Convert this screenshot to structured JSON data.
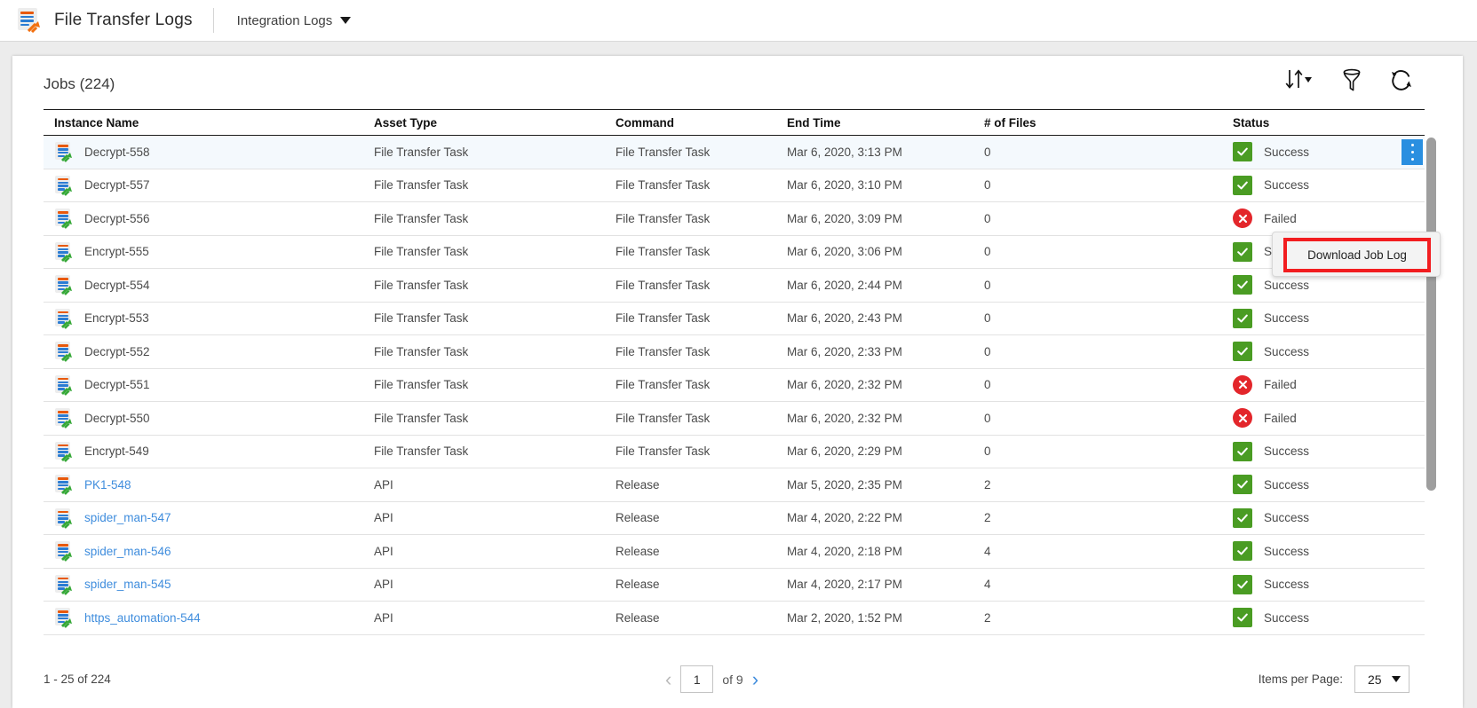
{
  "appbar": {
    "logo_icon": "file-transfer-logs-icon",
    "title": "File Transfer Logs",
    "menu_label": "Integration Logs",
    "menu_caret_icon": "chevron-down-icon"
  },
  "panel": {
    "title": "Jobs (224)",
    "actions": [
      {
        "name": "sort-icon",
        "label": "Sort"
      },
      {
        "name": "filter-icon",
        "label": "Filter"
      },
      {
        "name": "refresh-icon",
        "label": "Refresh"
      }
    ]
  },
  "table": {
    "columns": [
      "Instance Name",
      "Asset Type",
      "Command",
      "End Time",
      "# of Files",
      "Status"
    ],
    "rows": [
      {
        "name": "Decrypt-558",
        "link": false,
        "asset": "File Transfer Task",
        "command": "File Transfer Task",
        "end_time": "Mar 6, 2020, 3:13 PM",
        "files": "0",
        "status": "Success",
        "selected": true
      },
      {
        "name": "Decrypt-557",
        "link": false,
        "asset": "File Transfer Task",
        "command": "File Transfer Task",
        "end_time": "Mar 6, 2020, 3:10 PM",
        "files": "0",
        "status": "Success",
        "selected": false
      },
      {
        "name": "Decrypt-556",
        "link": false,
        "asset": "File Transfer Task",
        "command": "File Transfer Task",
        "end_time": "Mar 6, 2020, 3:09 PM",
        "files": "0",
        "status": "Failed",
        "selected": false
      },
      {
        "name": "Encrypt-555",
        "link": false,
        "asset": "File Transfer Task",
        "command": "File Transfer Task",
        "end_time": "Mar 6, 2020, 3:06 PM",
        "files": "0",
        "status": "Success",
        "selected": false
      },
      {
        "name": "Decrypt-554",
        "link": false,
        "asset": "File Transfer Task",
        "command": "File Transfer Task",
        "end_time": "Mar 6, 2020, 2:44 PM",
        "files": "0",
        "status": "Success",
        "selected": false
      },
      {
        "name": "Encrypt-553",
        "link": false,
        "asset": "File Transfer Task",
        "command": "File Transfer Task",
        "end_time": "Mar 6, 2020, 2:43 PM",
        "files": "0",
        "status": "Success",
        "selected": false
      },
      {
        "name": "Decrypt-552",
        "link": false,
        "asset": "File Transfer Task",
        "command": "File Transfer Task",
        "end_time": "Mar 6, 2020, 2:33 PM",
        "files": "0",
        "status": "Success",
        "selected": false
      },
      {
        "name": "Decrypt-551",
        "link": false,
        "asset": "File Transfer Task",
        "command": "File Transfer Task",
        "end_time": "Mar 6, 2020, 2:32 PM",
        "files": "0",
        "status": "Failed",
        "selected": false
      },
      {
        "name": "Decrypt-550",
        "link": false,
        "asset": "File Transfer Task",
        "command": "File Transfer Task",
        "end_time": "Mar 6, 2020, 2:32 PM",
        "files": "0",
        "status": "Failed",
        "selected": false
      },
      {
        "name": "Encrypt-549",
        "link": false,
        "asset": "File Transfer Task",
        "command": "File Transfer Task",
        "end_time": "Mar 6, 2020, 2:29 PM",
        "files": "0",
        "status": "Success",
        "selected": false
      },
      {
        "name": "PK1-548",
        "link": true,
        "asset": "API",
        "command": "Release",
        "end_time": "Mar 5, 2020, 2:35 PM",
        "files": "2",
        "status": "Success",
        "selected": false
      },
      {
        "name": "spider_man-547",
        "link": true,
        "asset": "API",
        "command": "Release",
        "end_time": "Mar 4, 2020, 2:22 PM",
        "files": "2",
        "status": "Success",
        "selected": false
      },
      {
        "name": "spider_man-546",
        "link": true,
        "asset": "API",
        "command": "Release",
        "end_time": "Mar 4, 2020, 2:18 PM",
        "files": "4",
        "status": "Success",
        "selected": false
      },
      {
        "name": "spider_man-545",
        "link": true,
        "asset": "API",
        "command": "Release",
        "end_time": "Mar 4, 2020, 2:17 PM",
        "files": "4",
        "status": "Success",
        "selected": false
      },
      {
        "name": "https_automation-544",
        "link": true,
        "asset": "API",
        "command": "Release",
        "end_time": "Mar 2, 2020, 1:52 PM",
        "files": "2",
        "status": "Success",
        "selected": false
      }
    ]
  },
  "context_menu": {
    "item_label": "Download Job Log",
    "highlight_color": "#f21d20"
  },
  "row_actions": {
    "kebab_icon": "more-options-icon"
  },
  "footer": {
    "range_text": "1 - 25   of   224",
    "prev_icon": "chevron-left-icon",
    "next_icon": "chevron-right-icon",
    "page_value": "1",
    "page_of_label": "of  9",
    "items_per_page_label": "Items per Page:",
    "items_per_page_value": "25"
  },
  "colors": {
    "success": "#4a9c23",
    "failed": "#e3262b",
    "link": "#3f8ddd",
    "accent_blue": "#2a8fe0"
  }
}
